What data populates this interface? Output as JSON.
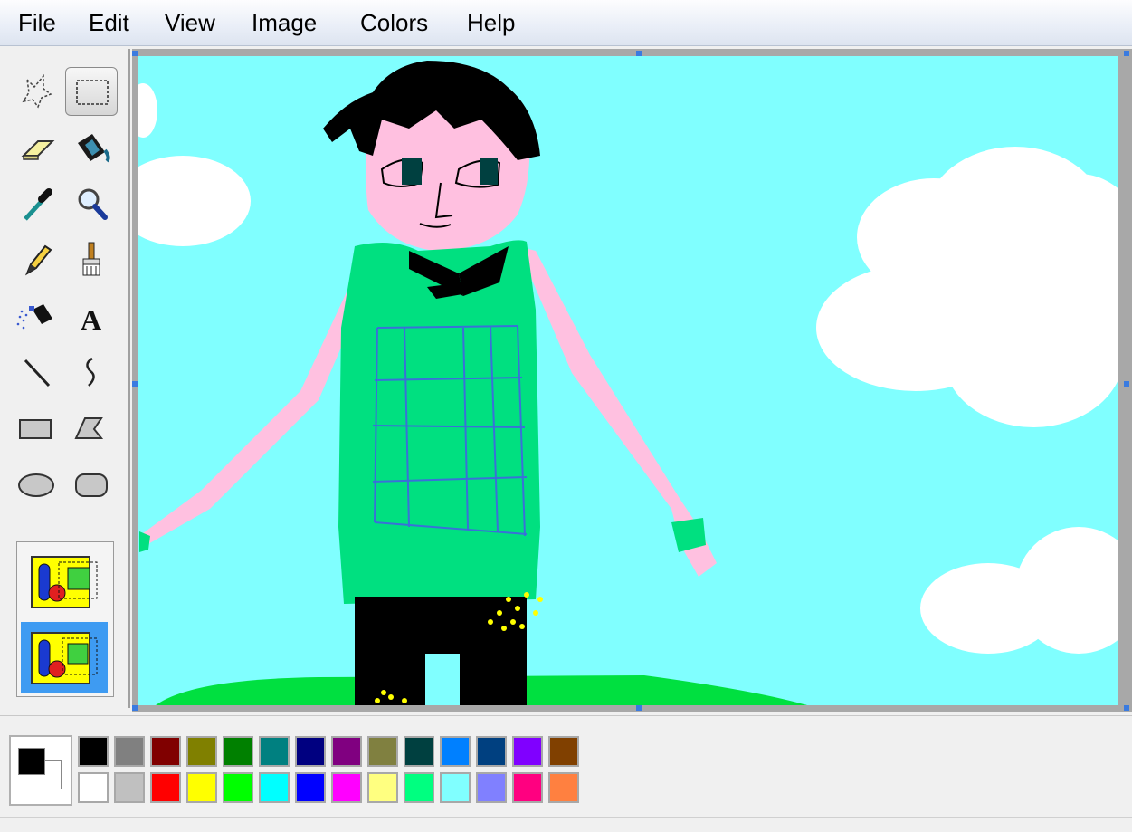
{
  "menu": {
    "file": "File",
    "edit": "Edit",
    "view": "View",
    "image": "Image",
    "colors": "Colors",
    "help": "Help"
  },
  "tools": [
    {
      "name": "free-form-select-icon"
    },
    {
      "name": "select-icon"
    },
    {
      "name": "eraser-icon"
    },
    {
      "name": "fill-bucket-icon"
    },
    {
      "name": "color-picker-icon"
    },
    {
      "name": "magnifier-icon"
    },
    {
      "name": "pencil-icon"
    },
    {
      "name": "brush-icon"
    },
    {
      "name": "airbrush-icon"
    },
    {
      "name": "text-icon"
    },
    {
      "name": "line-icon"
    },
    {
      "name": "curve-icon"
    },
    {
      "name": "rectangle-icon"
    },
    {
      "name": "polygon-icon"
    },
    {
      "name": "ellipse-icon"
    },
    {
      "name": "rounded-rectangle-icon"
    }
  ],
  "text_tool_glyph": "A",
  "selected_tool": "select-icon",
  "foreground_color": "#000000",
  "background_color": "#ffffff",
  "palette_top": [
    "#000000",
    "#808080",
    "#800000",
    "#808000",
    "#008000",
    "#008080",
    "#000080",
    "#800080",
    "#808040",
    "#004040",
    "#0080ff",
    "#004080",
    "#8000ff",
    "#804000"
  ],
  "palette_bottom": [
    "#ffffff",
    "#c0c0c0",
    "#ff0000",
    "#ffff00",
    "#00ff00",
    "#00ffff",
    "#0000ff",
    "#ff00ff",
    "#ffff80",
    "#00ff80",
    "#80ffff",
    "#8080ff",
    "#ff0080",
    "#ff8040"
  ],
  "canvas_colors": {
    "sky": "#80ffff",
    "skin": "#ffc0e0",
    "shirt": "#00e080",
    "hair": "#000000",
    "grass": "#00e040"
  }
}
